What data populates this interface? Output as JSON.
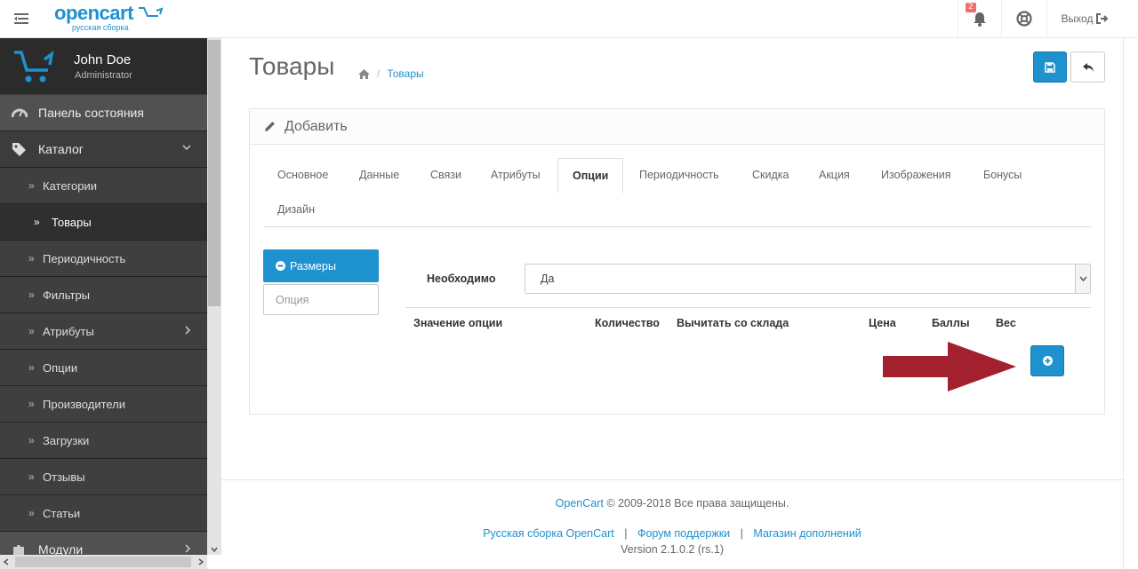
{
  "header": {
    "logo_main": "opencart",
    "logo_sub": "русская сборка",
    "notification_count": "2",
    "logout_label": "Выход"
  },
  "sidebar": {
    "user_name": "John Doe",
    "user_role": "Administrator",
    "items": [
      {
        "label": "Панель состояния",
        "level": "top",
        "icon": "dashboard-icon"
      },
      {
        "label": "Каталог",
        "level": "top",
        "icon": "tags-icon",
        "expanded": true
      },
      {
        "label": "Категории",
        "level": "sub"
      },
      {
        "label": "Товары",
        "level": "sub",
        "active": true
      },
      {
        "label": "Периодичность",
        "level": "sub"
      },
      {
        "label": "Фильтры",
        "level": "sub"
      },
      {
        "label": "Атрибуты",
        "level": "sub",
        "has_children": true
      },
      {
        "label": "Опции",
        "level": "sub"
      },
      {
        "label": "Производители",
        "level": "sub"
      },
      {
        "label": "Загрузки",
        "level": "sub"
      },
      {
        "label": "Отзывы",
        "level": "sub"
      },
      {
        "label": "Статьи",
        "level": "sub"
      },
      {
        "label": "Модули",
        "level": "top",
        "icon": "puzzle-icon"
      }
    ]
  },
  "page": {
    "title": "Товары",
    "breadcrumb_sep": "/",
    "breadcrumb_link": "Товары",
    "panel_title": "Добавить"
  },
  "tabs": [
    "Основное",
    "Данные",
    "Связи",
    "Атрибуты",
    "Опции",
    "Периодичность",
    "Скидка",
    "Акция",
    "Изображения",
    "Бонусы",
    "Дизайн"
  ],
  "active_tab": "Опции",
  "options": {
    "active_option": "Размеры",
    "option_placeholder": "Опция",
    "required_label": "Необходимо",
    "required_value": "Да",
    "columns": [
      "Значение опции",
      "Количество",
      "Вычитать со склада",
      "Цена",
      "Баллы",
      "Вес"
    ]
  },
  "footer": {
    "brand": "OpenCart",
    "copyright": "© 2009-2018 Все права защищены.",
    "link1": "Русская сборка OpenCart",
    "link2": "Форум поддержки",
    "link3": "Магазин дополнений",
    "divider": "|",
    "version": "Version 2.1.0.2 (rs.1)"
  },
  "colors": {
    "primary": "#1e91cf",
    "sidebar_bg": "#2b2b2b",
    "arrow": "#a3202f"
  }
}
